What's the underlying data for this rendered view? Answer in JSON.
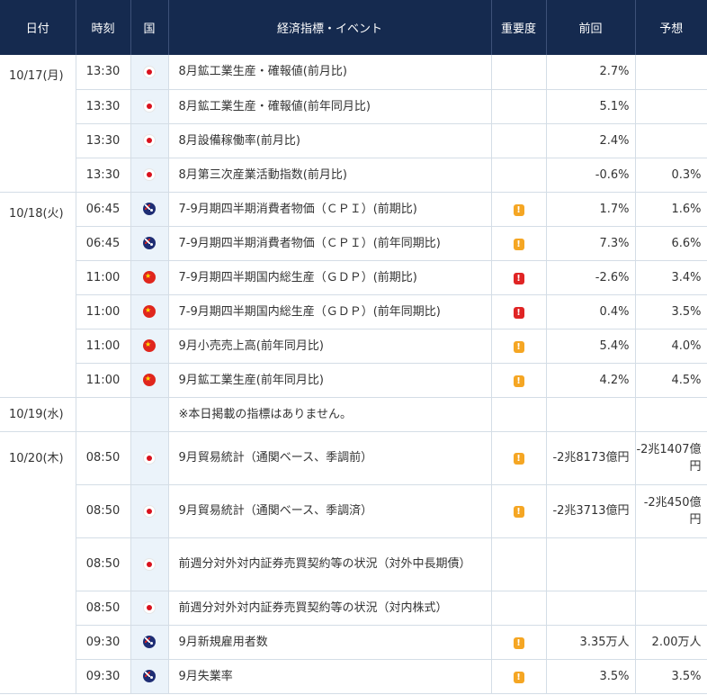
{
  "header": {
    "date": "日付",
    "time": "時刻",
    "country": "国",
    "event": "経済指標・イベント",
    "importance": "重要度",
    "previous": "前回",
    "forecast": "予想"
  },
  "dates": {
    "d17": "10/17(月)",
    "d18": "10/18(火)",
    "d19": "10/19(水)",
    "d20": "10/20(木)"
  },
  "importance_mark": "!",
  "no_events_text": "※本日掲載の指標はありません。",
  "rows": [
    {
      "time": "13:30",
      "flag": "jp",
      "event": "8月鉱工業生産・確報値(前月比)",
      "imp": "",
      "prev": "2.7%",
      "fcst": ""
    },
    {
      "time": "13:30",
      "flag": "jp",
      "event": "8月鉱工業生産・確報値(前年同月比)",
      "imp": "",
      "prev": "5.1%",
      "fcst": ""
    },
    {
      "time": "13:30",
      "flag": "jp",
      "event": "8月設備稼働率(前月比)",
      "imp": "",
      "prev": "2.4%",
      "fcst": ""
    },
    {
      "time": "13:30",
      "flag": "jp",
      "event": "8月第三次産業活動指数(前月比)",
      "imp": "",
      "prev": "-0.6%",
      "fcst": "0.3%"
    },
    {
      "time": "06:45",
      "flag": "nz",
      "event": "7-9月期四半期消費者物価（ＣＰＩ）(前期比)",
      "imp": "mid",
      "prev": "1.7%",
      "fcst": "1.6%"
    },
    {
      "time": "06:45",
      "flag": "nz",
      "event": "7-9月期四半期消費者物価（ＣＰＩ）(前年同期比)",
      "imp": "mid",
      "prev": "7.3%",
      "fcst": "6.6%"
    },
    {
      "time": "11:00",
      "flag": "cn",
      "event": "7-9月期四半期国内総生産（ＧＤＰ）(前期比)",
      "imp": "high",
      "prev": "-2.6%",
      "fcst": "3.4%"
    },
    {
      "time": "11:00",
      "flag": "cn",
      "event": "7-9月期四半期国内総生産（ＧＤＰ）(前年同期比)",
      "imp": "high",
      "prev": "0.4%",
      "fcst": "3.5%"
    },
    {
      "time": "11:00",
      "flag": "cn",
      "event": "9月小売売上高(前年同月比)",
      "imp": "mid",
      "prev": "5.4%",
      "fcst": "4.0%"
    },
    {
      "time": "11:00",
      "flag": "cn",
      "event": "9月鉱工業生産(前年同月比)",
      "imp": "mid",
      "prev": "4.2%",
      "fcst": "4.5%"
    },
    {
      "time": "08:50",
      "flag": "jp",
      "event": "9月貿易統計（通関ベース、季調前）",
      "imp": "mid",
      "prev": "-2兆8173億円",
      "fcst": "-2兆1407億円"
    },
    {
      "time": "08:50",
      "flag": "jp",
      "event": "9月貿易統計（通関ベース、季調済）",
      "imp": "mid",
      "prev": "-2兆3713億円",
      "fcst": "-2兆450億円"
    },
    {
      "time": "08:50",
      "flag": "jp",
      "event": "前週分対外対内証券売買契約等の状況（対外中長期債）",
      "imp": "",
      "prev": "",
      "fcst": ""
    },
    {
      "time": "08:50",
      "flag": "jp",
      "event": "前週分対外対内証券売買契約等の状況（対内株式）",
      "imp": "",
      "prev": "",
      "fcst": ""
    },
    {
      "time": "09:30",
      "flag": "au",
      "event": "9月新規雇用者数",
      "imp": "mid",
      "prev": "3.35万人",
      "fcst": "2.00万人"
    },
    {
      "time": "09:30",
      "flag": "au",
      "event": "9月失業率",
      "imp": "mid",
      "prev": "3.5%",
      "fcst": "3.5%"
    }
  ],
  "colors": {
    "header_bg": "#152a4f",
    "flag_col_bg": "#ebf3fa",
    "importance_mid": "#f5a623",
    "importance_high": "#e02424"
  }
}
